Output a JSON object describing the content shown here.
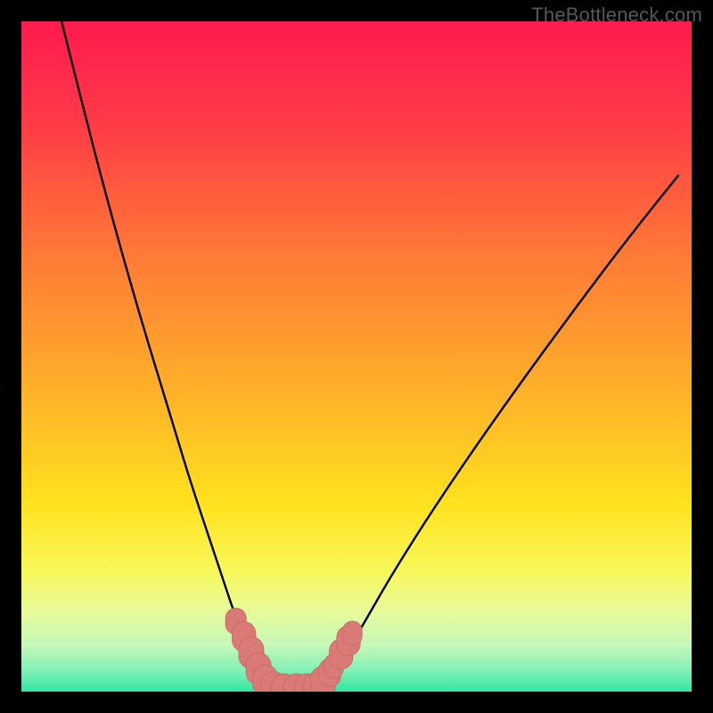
{
  "watermark": "TheBottleneck.com",
  "colors": {
    "frame": "#000000",
    "gradient_stops": [
      {
        "offset": 0.0,
        "color": "#ff1a4f"
      },
      {
        "offset": 0.15,
        "color": "#ff3a47"
      },
      {
        "offset": 0.35,
        "color": "#ff7a36"
      },
      {
        "offset": 0.55,
        "color": "#ffb029"
      },
      {
        "offset": 0.72,
        "color": "#ffe21e"
      },
      {
        "offset": 0.82,
        "color": "#f8f85a"
      },
      {
        "offset": 0.88,
        "color": "#e8fa9a"
      },
      {
        "offset": 0.93,
        "color": "#c6f8b8"
      },
      {
        "offset": 0.97,
        "color": "#7ef0b5"
      },
      {
        "offset": 1.0,
        "color": "#2fe6a2"
      }
    ],
    "curve": "#000000",
    "marker_fill": "#d97a76",
    "marker_stroke": "#c96864"
  },
  "chart_data": {
    "type": "line",
    "title": "",
    "xlabel": "",
    "ylabel": "",
    "xlim": [
      0,
      100
    ],
    "ylim": [
      0,
      100
    ],
    "series": [
      {
        "name": "left-curve",
        "x": [
          6,
          10,
          14,
          18,
          22,
          25,
          28,
          30,
          32,
          34.5,
          36.5,
          38
        ],
        "y": [
          100,
          84,
          69,
          55,
          42,
          32,
          23,
          17,
          11,
          5,
          1.5,
          0
        ]
      },
      {
        "name": "right-curve",
        "x": [
          44,
          46,
          48,
          51,
          55,
          60,
          66,
          73,
          81,
          90,
          98
        ],
        "y": [
          0,
          2,
          5,
          10,
          17,
          25,
          34,
          44,
          55,
          67,
          77
        ]
      },
      {
        "name": "valley-floor",
        "x": [
          38,
          40,
          42,
          44
        ],
        "y": [
          0,
          0,
          0,
          0
        ]
      }
    ],
    "markers": [
      {
        "x": 32.0,
        "y": 10.5,
        "r": 1.4
      },
      {
        "x": 33.2,
        "y": 8.2,
        "r": 1.6
      },
      {
        "x": 34.3,
        "y": 5.8,
        "r": 1.7
      },
      {
        "x": 35.4,
        "y": 3.4,
        "r": 1.7
      },
      {
        "x": 36.4,
        "y": 1.6,
        "r": 1.7
      },
      {
        "x": 37.6,
        "y": 0.6,
        "r": 1.7
      },
      {
        "x": 39.2,
        "y": 0.3,
        "r": 1.7
      },
      {
        "x": 41.0,
        "y": 0.3,
        "r": 1.7
      },
      {
        "x": 42.6,
        "y": 0.3,
        "r": 1.7
      },
      {
        "x": 44.0,
        "y": 0.5,
        "r": 1.7
      },
      {
        "x": 45.0,
        "y": 1.4,
        "r": 1.7
      },
      {
        "x": 46.0,
        "y": 2.8,
        "r": 1.5
      },
      {
        "x": 46.6,
        "y": 3.8,
        "r": 1.3
      },
      {
        "x": 47.7,
        "y": 5.6,
        "r": 1.6
      },
      {
        "x": 48.8,
        "y": 7.6,
        "r": 1.6
      },
      {
        "x": 49.4,
        "y": 8.7,
        "r": 1.3
      }
    ]
  }
}
